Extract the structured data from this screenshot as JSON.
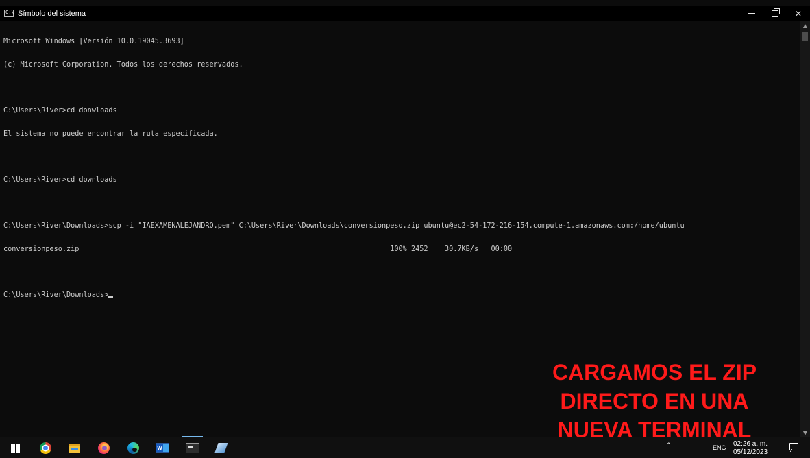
{
  "window": {
    "title": "Símbolo del sistema",
    "controls": [
      "minimize",
      "restore",
      "close"
    ],
    "close_glyph": "✕"
  },
  "console_lines": [
    "Microsoft Windows [Versión 10.0.19045.3693]",
    "(c) Microsoft Corporation. Todos los derechos reservados.",
    "",
    "C:\\Users\\River>cd donwloads",
    "El sistema no puede encontrar la ruta especificada.",
    "",
    "C:\\Users\\River>cd downloads",
    "",
    "C:\\Users\\River\\Downloads>scp -i \"IAEXAMENALEJANDRO.pem\" C:\\Users\\River\\Downloads\\conversionpeso.zip ubuntu@ec2-54-172-216-154.compute-1.amazonaws.com:/home/ubuntu",
    "conversionpeso.zip                                                                          100% 2452    30.7KB/s   00:00",
    "",
    "C:\\Users\\River\\Downloads>"
  ],
  "overlay": {
    "lines": [
      "CARGAMOS EL ZIP",
      "DIRECTO EN UNA",
      "NUEVA TERMINAL"
    ],
    "color": "#ff1a1a"
  },
  "taskbar": {
    "apps": [
      "start-icon",
      "chrome-icon",
      "file-explorer-icon",
      "firefox-icon",
      "edge-icon",
      "word-icon",
      "cmd-icon",
      "app-icon"
    ],
    "tray": {
      "chevron": "^",
      "lang": "ENG",
      "time": "02:26 a. m.",
      "date": "05/12/2023"
    }
  },
  "colors": {
    "console_bg": "#0c0c0c",
    "console_text": "#cccccc",
    "titlebar": "#000000",
    "taskbar": "#101010"
  }
}
